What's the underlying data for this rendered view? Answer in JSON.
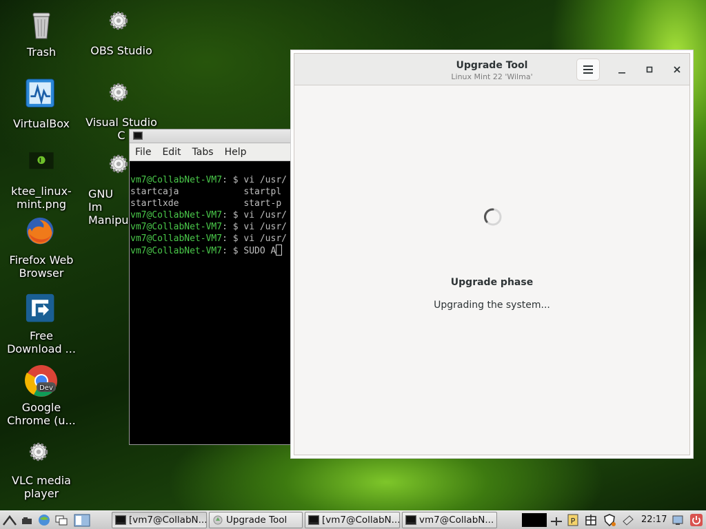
{
  "desktop": {
    "icons": [
      {
        "label": "Trash",
        "icon": "trash-icon"
      },
      {
        "label": "OBS Studio",
        "icon": "gear-icon"
      },
      {
        "label": "VirtualBox",
        "icon": "virtualbox-icon"
      },
      {
        "label": "Visual Studio C",
        "icon": "gear-icon"
      },
      {
        "label": "ktee_linux-mint.png",
        "icon": "image-file-icon"
      },
      {
        "label": "GNU Im Manipu",
        "icon": "gear-icon"
      },
      {
        "label": "Firefox Web Browser",
        "icon": "firefox-icon"
      },
      {
        "label": "Free Download ...",
        "icon": "download-manager-icon"
      },
      {
        "label": "Google Chrome (u...",
        "icon": "chrome-dev-icon"
      },
      {
        "label": "VLC media player",
        "icon": "gear-icon"
      }
    ]
  },
  "terminal": {
    "menu": [
      "File",
      "Edit",
      "Tabs",
      "Help"
    ],
    "lines": [
      {
        "prompt": "vm7@CollabNet-VM7",
        "cmd": ": $ vi /usr/"
      },
      {
        "prompt": "",
        "cmd": "startcaja            startpl"
      },
      {
        "prompt": "",
        "cmd": "startlxde            start-p"
      },
      {
        "prompt": "vm7@CollabNet-VM7",
        "cmd": ": $ vi /usr/"
      },
      {
        "prompt": "vm7@CollabNet-VM7",
        "cmd": ": $ vi /usr/"
      },
      {
        "prompt": "vm7@CollabNet-VM7",
        "cmd": ": $ vi /usr/"
      },
      {
        "prompt": "vm7@CollabNet-VM7",
        "cmd": ": $ SUDO A"
      }
    ]
  },
  "upgrade_tool": {
    "title": "Upgrade Tool",
    "subtitle": "Linux Mint 22 'Wilma'",
    "phase": "Upgrade phase",
    "status": "Upgrading the system..."
  },
  "taskbar": {
    "tasks": [
      {
        "label": "[vm7@CollabN...",
        "icon": "terminal-icon"
      },
      {
        "label": "Upgrade Tool",
        "icon": "upgrade-icon"
      },
      {
        "label": "[vm7@CollabN...",
        "icon": "terminal-icon"
      },
      {
        "label": "vm7@CollabN...",
        "icon": "terminal-icon"
      }
    ],
    "clock": "22:17"
  }
}
